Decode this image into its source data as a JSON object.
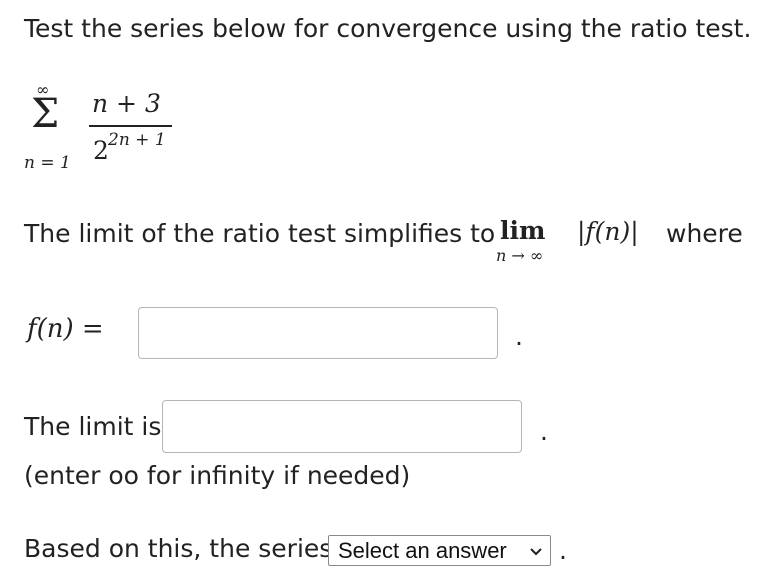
{
  "question": {
    "prompt": "Test the series below for convergence using the ratio test."
  },
  "series": {
    "sum_symbol": "Σ",
    "upper_limit": "∞",
    "lower_limit": "n = 1",
    "numerator": "n + 3",
    "denominator_base": "2",
    "denominator_exponent": "2n + 1"
  },
  "ratio_statement": {
    "text": "The limit of the ratio test simplifies to",
    "lim_label": "lim",
    "lim_subscript": "n → ∞",
    "abs_expression": "|f(n)|",
    "where_text": "where"
  },
  "f_row": {
    "label": "f(n) =",
    "input_value": "",
    "trailing": "."
  },
  "limit_row": {
    "label": "The limit is",
    "input_value": "",
    "trailing": "."
  },
  "hint": {
    "text": "(enter oo for infinity if needed)"
  },
  "conclusion_row": {
    "text": "Based on this, the series",
    "select_value": "Select an answer",
    "trailing": "."
  }
}
